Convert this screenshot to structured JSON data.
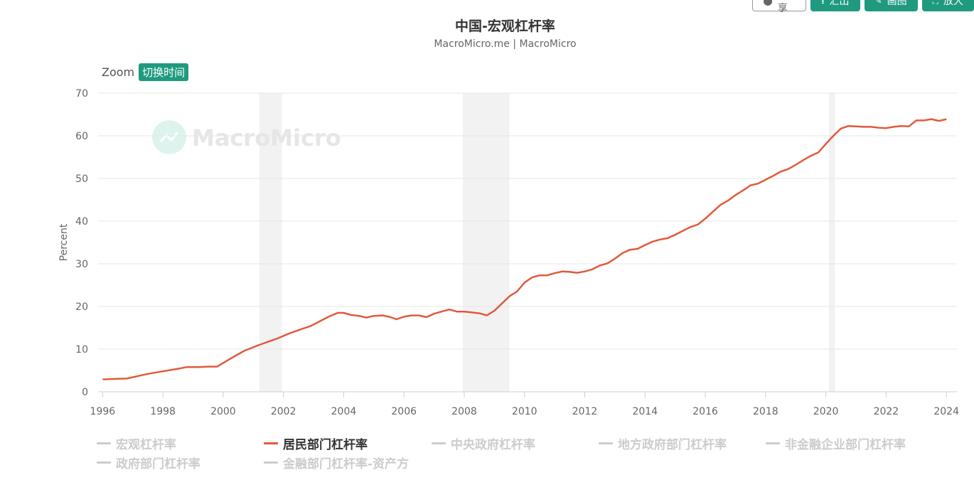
{
  "toolbar": {
    "share_label": "分享",
    "export_label": "汇出",
    "draw_label": "画图",
    "expand_label": "放大"
  },
  "title": "中国-宏观杠杆率",
  "subtitle": "MacroMicro.me | MacroMicro",
  "zoom": {
    "label": "Zoom",
    "button": "切换时间"
  },
  "watermark": "MacroMicro",
  "colors": {
    "series": "#e05a3c",
    "accent": "#1f9a7f",
    "recession": "#f2f2f2",
    "inactive": "#cccccc"
  },
  "legend": [
    {
      "label": "宏观杠杆率",
      "active": false
    },
    {
      "label": "居民部门杠杆率",
      "active": true
    },
    {
      "label": "中央政府杠杆率",
      "active": false
    },
    {
      "label": "地方政府部门杠杆率",
      "active": false
    },
    {
      "label": "非金融企业部门杠杆率",
      "active": false
    },
    {
      "label": "政府部门杠杆率",
      "active": false
    },
    {
      "label": "金融部门杠杆率-资产方",
      "active": false
    }
  ],
  "chart_data": {
    "type": "line",
    "ylabel": "Percent",
    "xlabel": "",
    "ylim": [
      0,
      70
    ],
    "xlim": [
      1995.85,
      2024.35
    ],
    "yticks": [
      0,
      10,
      20,
      30,
      40,
      50,
      60,
      70
    ],
    "xticks": [
      "1996",
      "1998",
      "2000",
      "2002",
      "2004",
      "2006",
      "2008",
      "2010",
      "2012",
      "2014",
      "2016",
      "2018",
      "2020",
      "2022",
      "2024"
    ],
    "grid": true,
    "recession_bands": [
      [
        2001.2,
        2001.95
      ],
      [
        2007.95,
        2009.5
      ],
      [
        2020.1,
        2020.3
      ]
    ],
    "series": [
      {
        "name": "居民部门杠杆率",
        "points": [
          [
            1996.0,
            2.9
          ],
          [
            1996.3,
            3.0
          ],
          [
            1996.8,
            3.1
          ],
          [
            1997.5,
            4.2
          ],
          [
            1998.0,
            4.8
          ],
          [
            1998.5,
            5.4
          ],
          [
            1998.8,
            5.8
          ],
          [
            1999.2,
            5.8
          ],
          [
            1999.5,
            5.9
          ],
          [
            1999.8,
            5.9
          ],
          [
            2000.2,
            7.6
          ],
          [
            2000.7,
            9.6
          ],
          [
            2001.2,
            11.0
          ],
          [
            2001.8,
            12.5
          ],
          [
            2002.2,
            13.7
          ],
          [
            2002.6,
            14.7
          ],
          [
            2002.9,
            15.4
          ],
          [
            2003.2,
            16.5
          ],
          [
            2003.5,
            17.6
          ],
          [
            2003.8,
            18.5
          ],
          [
            2004.0,
            18.5
          ],
          [
            2004.25,
            18.0
          ],
          [
            2004.5,
            17.8
          ],
          [
            2004.75,
            17.4
          ],
          [
            2005.0,
            17.8
          ],
          [
            2005.3,
            17.9
          ],
          [
            2005.55,
            17.5
          ],
          [
            2005.75,
            17.0
          ],
          [
            2006.0,
            17.6
          ],
          [
            2006.25,
            17.9
          ],
          [
            2006.5,
            17.9
          ],
          [
            2006.75,
            17.5
          ],
          [
            2007.0,
            18.3
          ],
          [
            2007.25,
            18.8
          ],
          [
            2007.5,
            19.3
          ],
          [
            2007.75,
            18.8
          ],
          [
            2008.0,
            18.8
          ],
          [
            2008.25,
            18.6
          ],
          [
            2008.5,
            18.4
          ],
          [
            2008.75,
            17.9
          ],
          [
            2009.0,
            19.0
          ],
          [
            2009.25,
            20.7
          ],
          [
            2009.5,
            22.4
          ],
          [
            2009.75,
            23.5
          ],
          [
            2010.0,
            25.6
          ],
          [
            2010.25,
            26.8
          ],
          [
            2010.5,
            27.3
          ],
          [
            2010.75,
            27.3
          ],
          [
            2011.0,
            27.8
          ],
          [
            2011.25,
            28.2
          ],
          [
            2011.5,
            28.1
          ],
          [
            2011.75,
            27.9
          ],
          [
            2012.0,
            28.2
          ],
          [
            2012.25,
            28.7
          ],
          [
            2012.5,
            29.6
          ],
          [
            2012.75,
            30.1
          ],
          [
            2013.0,
            31.2
          ],
          [
            2013.25,
            32.5
          ],
          [
            2013.5,
            33.3
          ],
          [
            2013.75,
            33.5
          ],
          [
            2014.0,
            34.4
          ],
          [
            2014.25,
            35.2
          ],
          [
            2014.5,
            35.7
          ],
          [
            2014.75,
            36.0
          ],
          [
            2015.0,
            36.8
          ],
          [
            2015.25,
            37.7
          ],
          [
            2015.5,
            38.6
          ],
          [
            2015.75,
            39.2
          ],
          [
            2016.0,
            40.6
          ],
          [
            2016.25,
            42.2
          ],
          [
            2016.5,
            43.8
          ],
          [
            2016.75,
            44.8
          ],
          [
            2017.0,
            46.1
          ],
          [
            2017.25,
            47.2
          ],
          [
            2017.5,
            48.4
          ],
          [
            2017.75,
            48.8
          ],
          [
            2018.0,
            49.7
          ],
          [
            2018.25,
            50.6
          ],
          [
            2018.5,
            51.6
          ],
          [
            2018.75,
            52.2
          ],
          [
            2019.0,
            53.2
          ],
          [
            2019.25,
            54.3
          ],
          [
            2019.5,
            55.3
          ],
          [
            2019.75,
            56.1
          ],
          [
            2020.0,
            58.1
          ],
          [
            2020.25,
            60.0
          ],
          [
            2020.5,
            61.7
          ],
          [
            2020.75,
            62.3
          ],
          [
            2021.0,
            62.2
          ],
          [
            2021.25,
            62.1
          ],
          [
            2021.5,
            62.1
          ],
          [
            2021.75,
            61.9
          ],
          [
            2022.0,
            61.8
          ],
          [
            2022.25,
            62.1
          ],
          [
            2022.5,
            62.3
          ],
          [
            2022.75,
            62.2
          ],
          [
            2023.0,
            63.6
          ],
          [
            2023.25,
            63.6
          ],
          [
            2023.5,
            63.9
          ],
          [
            2023.75,
            63.5
          ],
          [
            2024.0,
            63.9
          ]
        ]
      }
    ]
  }
}
